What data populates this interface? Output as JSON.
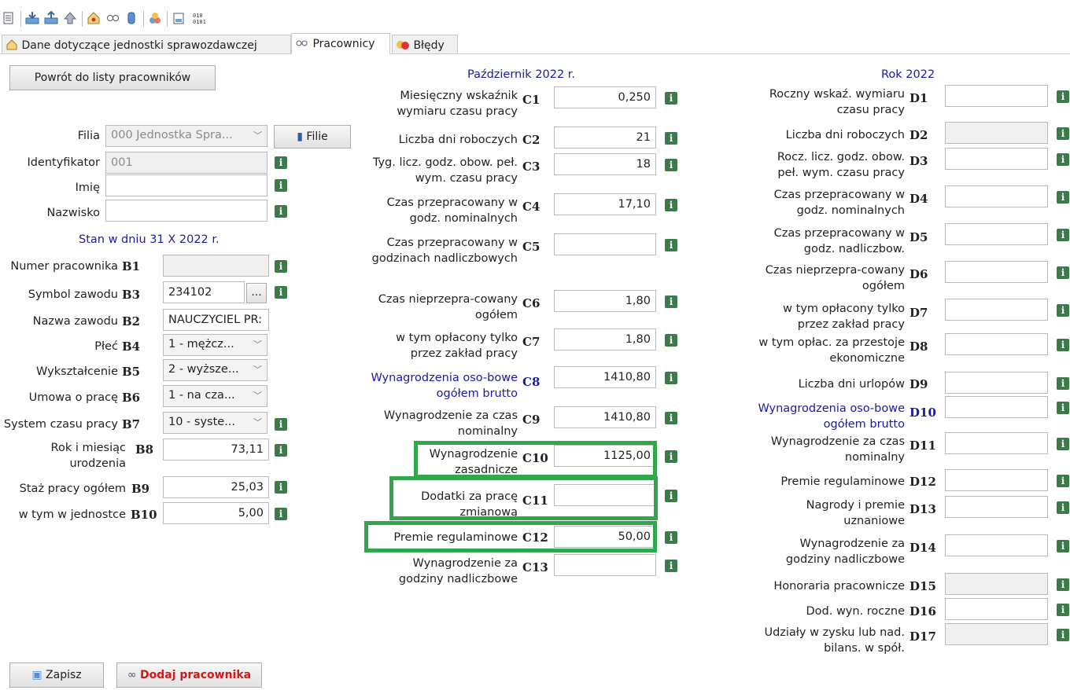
{
  "toolbar": {
    "icons": [
      "print-icon",
      "import-icon",
      "export-icon",
      "upload-icon",
      "house-person-icon",
      "employee-icon",
      "database-icon",
      "group-icon",
      "filter-icon",
      "binary-icon"
    ]
  },
  "tabs": [
    {
      "label": "Dane dotyczące jednostki sprawozdawczej"
    },
    {
      "label": "Pracownicy"
    },
    {
      "label": "Błędy"
    }
  ],
  "left": {
    "back_label": "Powrót do listy pracowników",
    "filia_label": "Filia",
    "filia_value": "000 Jednostka Spra...",
    "filie_label": "Filie",
    "identyfikator_label": "Identyfikator",
    "identyfikator_value": "001",
    "imie_label": "Imię",
    "imie_value": "",
    "nazwisko_label": "Nazwisko",
    "nazwisko_value": "",
    "stan_header": "Stan w dniu 31 X 2022 r.",
    "b1_label": "Numer pracownika",
    "b1_code": "B1",
    "b1_value": "",
    "b3_label": "Symbol zawodu",
    "b3_code": "B3",
    "b3_value": "234102",
    "b3_btn": "...",
    "b2_label": "Nazwa zawodu",
    "b2_code": "B2",
    "b2_value": "NAUCZYCIEL PR:",
    "b4_label": "Płeć",
    "b4_code": "B4",
    "b4_value": "1 - mężcz...",
    "b5_label": "Wykształcenie",
    "b5_code": "B5",
    "b5_value": "2 - wyższe...",
    "b6_label": "Umowa o pracę",
    "b6_code": "B6",
    "b6_value": "1 - na cza...",
    "b7_label": "System czasu pracy",
    "b7_code": "B7",
    "b7_value": "10 - syste...",
    "b8_label": "Rok i miesiąc urodzenia",
    "b8_code": "B8",
    "b8_value": "73,11",
    "b9_label": "Staż pracy ogółem",
    "b9_code": "B9",
    "b9_value": "25,03",
    "b10_label": "w tym w jednostce",
    "b10_code": "B10",
    "b10_value": "5,00",
    "save_label": "Zapisz",
    "add_label": "Dodaj pracownika"
  },
  "mid": {
    "header": "Październik 2022 r.",
    "rows": [
      {
        "code": "C1",
        "label": "Miesięczny wskaźnik wymiaru czasu pracy",
        "value": "0,250"
      },
      {
        "code": "C2",
        "label": "Liczba dni roboczych",
        "value": "21"
      },
      {
        "code": "C3",
        "label": "Tyg. licz. godz. obow. peł. wym. czasu pracy",
        "value": "18"
      },
      {
        "code": "C4",
        "label": "Czas przepracowany w godz. nominalnych",
        "value": "17,10"
      },
      {
        "code": "C5",
        "label": "Czas przepracowany w godzinach nadliczbowych",
        "value": ""
      },
      {
        "code": "C6",
        "label": "Czas nieprzepra-cowany ogółem",
        "value": "1,80"
      },
      {
        "code": "C7",
        "label": "w tym opłacony tylko przez zakład pracy",
        "value": "1,80"
      },
      {
        "code": "C8",
        "label": "Wynagrodzenia oso-bowe ogółem brutto",
        "value": "1410,80"
      },
      {
        "code": "C9",
        "label": "Wynagrodzenie za czas nominalny",
        "value": "1410,80"
      },
      {
        "code": "C10",
        "label": "Wynagrodzenie zasadnicze",
        "value": "1125,00"
      },
      {
        "code": "C11",
        "label": "Dodatki za pracę zmianową",
        "value": ""
      },
      {
        "code": "C12",
        "label": "Premie regulaminowe",
        "value": "50,00"
      },
      {
        "code": "C13",
        "label": "Wynagrodzenie za godziny nadliczbowe",
        "value": ""
      }
    ]
  },
  "right": {
    "header": "Rok 2022",
    "rows": [
      {
        "code": "D1",
        "label": "Roczny wskaź. wymiaru czasu pracy",
        "value": ""
      },
      {
        "code": "D2",
        "label": "Liczba dni roboczych",
        "value": ""
      },
      {
        "code": "D3",
        "label": "Rocz. licz. godz. obow. peł. wym. czasu pracy",
        "value": ""
      },
      {
        "code": "D4",
        "label": "Czas przepracowany w godz. nominalnych",
        "value": ""
      },
      {
        "code": "D5",
        "label": "Czas przepracowany w godz. nadliczbow.",
        "value": ""
      },
      {
        "code": "D6",
        "label": "Czas nieprzepra-cowany ogółem",
        "value": ""
      },
      {
        "code": "D7",
        "label": "w tym opłacony tylko przez zakład pracy",
        "value": ""
      },
      {
        "code": "D8",
        "label": "w tym opłac. za przestoje ekonomiczne",
        "value": ""
      },
      {
        "code": "D9",
        "label": "Liczba dni urlopów",
        "value": ""
      },
      {
        "code": "D10",
        "label": "Wynagrodzenia oso-bowe ogółem brutto",
        "value": ""
      },
      {
        "code": "D11",
        "label": "Wynagrodzenie za czas nominalny",
        "value": ""
      },
      {
        "code": "D12",
        "label": "Premie regulaminowe",
        "value": ""
      },
      {
        "code": "D13",
        "label": "Nagrody i premie uznaniowe",
        "value": ""
      },
      {
        "code": "D14",
        "label": "Wynagrodzenie za godziny nadliczbowe",
        "value": ""
      },
      {
        "code": "D15",
        "label": "Honoraria pracownicze",
        "value": ""
      },
      {
        "code": "D16",
        "label": "Dod. wyn. roczne",
        "value": ""
      },
      {
        "code": "D17",
        "label": "Udziały w zysku lub nad. bilans. w spół.",
        "value": ""
      }
    ]
  },
  "colors": {
    "highlight": "#2ea84a",
    "info": "#3c7a4a",
    "header_blue": "#1a1aa6",
    "add_red": "#d31818"
  }
}
